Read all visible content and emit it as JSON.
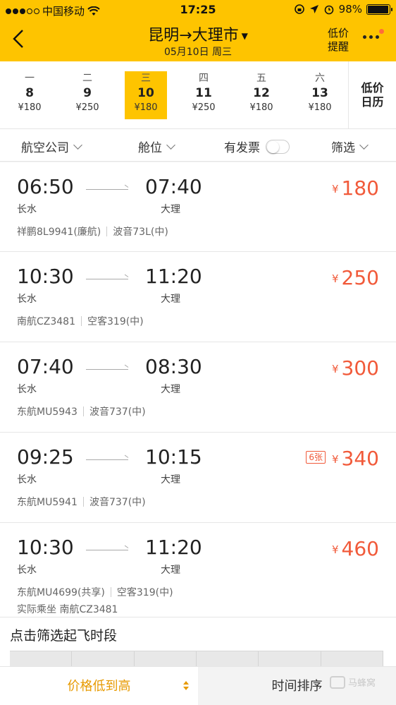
{
  "status": {
    "carrier": "中国移动",
    "time": "17:25",
    "battery": "98%",
    "battery_level": 0.98
  },
  "nav": {
    "title": "昆明→大理市",
    "subtitle": "05月10日 周三",
    "low_price_alert": "低价提醒"
  },
  "dates": [
    {
      "weekday": "一",
      "date": "8",
      "price": "¥180"
    },
    {
      "weekday": "二",
      "date": "9",
      "price": "¥250"
    },
    {
      "weekday": "三",
      "date": "10",
      "price": "¥180"
    },
    {
      "weekday": "四",
      "date": "11",
      "price": "¥250"
    },
    {
      "weekday": "五",
      "date": "12",
      "price": "¥180"
    },
    {
      "weekday": "六",
      "date": "13",
      "price": "¥180"
    }
  ],
  "calendar_label": "低价日历",
  "filters": {
    "airline": "航空公司",
    "cabin": "舱位",
    "invoice": "有发票",
    "filter": "筛选"
  },
  "flights": [
    {
      "dep_time": "06:50",
      "arr_time": "07:40",
      "dep_airport": "长水",
      "arr_airport": "大理",
      "price": "180",
      "airline_flight": "祥鹏8L9941(廉航)",
      "aircraft": "波音73L(中)"
    },
    {
      "dep_time": "10:30",
      "arr_time": "11:20",
      "dep_airport": "长水",
      "arr_airport": "大理",
      "price": "250",
      "airline_flight": "南航CZ3481",
      "aircraft": "空客319(中)"
    },
    {
      "dep_time": "07:40",
      "arr_time": "08:30",
      "dep_airport": "长水",
      "arr_airport": "大理",
      "price": "300",
      "airline_flight": "东航MU5943",
      "aircraft": "波音737(中)"
    },
    {
      "dep_time": "09:25",
      "arr_time": "10:15",
      "dep_airport": "长水",
      "arr_airport": "大理",
      "price": "340",
      "seats_left": "6张",
      "airline_flight": "东航MU5941",
      "aircraft": "波音737(中)"
    },
    {
      "dep_time": "10:30",
      "arr_time": "11:20",
      "dep_airport": "长水",
      "arr_airport": "大理",
      "price": "460",
      "airline_flight": "东航MU4699(共享)",
      "aircraft": "空客319(中)",
      "actual_carrier": "实际乘坐 南航CZ3481"
    }
  ],
  "currency_symbol": "¥",
  "slot_filter_title": "点击筛选起飞时段",
  "bottom": {
    "sort_price": "价格低到高",
    "sort_time": "时间排序"
  },
  "watermark": "马蜂窝"
}
